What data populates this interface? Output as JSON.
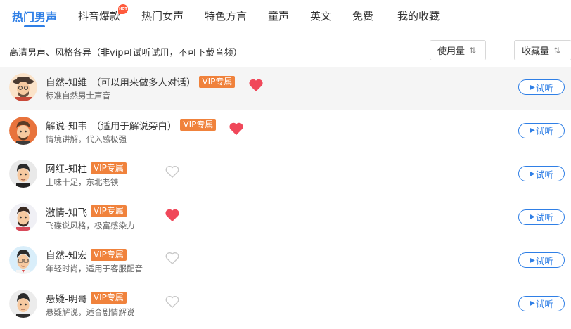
{
  "tabs": [
    {
      "label": "热门男声",
      "active": true
    },
    {
      "label": "抖音爆款",
      "badge": "HOT"
    },
    {
      "label": "热门女声"
    },
    {
      "label": "特色方言"
    },
    {
      "label": "童声"
    },
    {
      "label": "英文"
    },
    {
      "label": "免费"
    },
    {
      "label": "我的收藏"
    }
  ],
  "description": "高清男声、风格各异（非vip可试听试用，不可下载音频）",
  "sort": {
    "usage_label": "使用量",
    "fav_label": "收藏量",
    "icon": "⇅"
  },
  "listen_label": "试听",
  "play_icon": "▶",
  "voices": [
    {
      "name": "自然-知维",
      "note": "（可以用来做多人对话）",
      "vip": "VIP专属",
      "desc": "标准自然男士声音",
      "favorited": true
    },
    {
      "name": "解说-知韦",
      "note": "（适用于解说旁白）",
      "vip": "VIP专属",
      "desc": "情境讲解，代入感极强",
      "favorited": true
    },
    {
      "name": "网红-知柱",
      "note": "",
      "vip": "VIP专属",
      "desc": "土味十足，东北老铁",
      "favorited": false
    },
    {
      "name": "激情-知飞",
      "note": "",
      "vip": "VIP专属",
      "desc": "飞碟说风格，极富感染力",
      "favorited": true
    },
    {
      "name": "自然-知宏",
      "note": "",
      "vip": "VIP专属",
      "desc": "年轻时尚，适用于客服配音",
      "favorited": false
    },
    {
      "name": "悬疑-明哥",
      "note": "",
      "vip": "VIP专属",
      "desc": "悬疑解说，适合剧情解说",
      "favorited": false
    }
  ],
  "colors": {
    "accent": "#2f7fe6",
    "vip": "#f0823c",
    "heart_on": "#f0485a",
    "heart_off": "#c8c8c8"
  }
}
